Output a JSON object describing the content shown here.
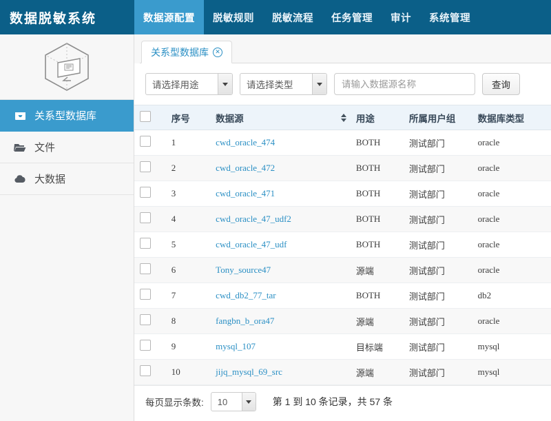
{
  "header": {
    "brand_title": "数据脱敏系统",
    "nav": [
      {
        "label": "数据源配置",
        "active": true
      },
      {
        "label": "脱敏规则",
        "active": false
      },
      {
        "label": "脱敏流程",
        "active": false
      },
      {
        "label": "任务管理",
        "active": false
      },
      {
        "label": "审计",
        "active": false
      },
      {
        "label": "系统管理",
        "active": false
      }
    ]
  },
  "sidebar": {
    "logo_icon": "hexagon-monitor-logo-icon",
    "items": [
      {
        "label": "关系型数据库",
        "icon": "database-inbox-icon",
        "active": true
      },
      {
        "label": "文件",
        "icon": "folder-open-icon",
        "active": false
      },
      {
        "label": "大数据",
        "icon": "cloud-icon",
        "active": false
      }
    ]
  },
  "tabs": [
    {
      "label": "关系型数据库",
      "closable": true,
      "active": true
    }
  ],
  "filters": {
    "purpose_select": "请选择用途",
    "type_select": "请选择类型",
    "search_placeholder": "请输入数据源名称",
    "search_value": "",
    "query_button": "查询"
  },
  "table": {
    "columns": [
      "",
      "序号",
      "数据源",
      "用途",
      "所属用户组",
      "数据库类型"
    ],
    "sortable_column": "数据源",
    "rows": [
      {
        "no": "1",
        "datasource": "cwd_oracle_474",
        "usage": "BOTH",
        "group": "测试部门",
        "dbtype": "oracle"
      },
      {
        "no": "2",
        "datasource": "cwd_oracle_472",
        "usage": "BOTH",
        "group": "测试部门",
        "dbtype": "oracle"
      },
      {
        "no": "3",
        "datasource": "cwd_oracle_471",
        "usage": "BOTH",
        "group": "测试部门",
        "dbtype": "oracle"
      },
      {
        "no": "4",
        "datasource": "cwd_oracle_47_udf2",
        "usage": "BOTH",
        "group": "测试部门",
        "dbtype": "oracle"
      },
      {
        "no": "5",
        "datasource": "cwd_oracle_47_udf",
        "usage": "BOTH",
        "group": "测试部门",
        "dbtype": "oracle"
      },
      {
        "no": "6",
        "datasource": "Tony_source47",
        "usage": "源端",
        "group": "测试部门",
        "dbtype": "oracle"
      },
      {
        "no": "7",
        "datasource": "cwd_db2_77_tar",
        "usage": "BOTH",
        "group": "测试部门",
        "dbtype": "db2"
      },
      {
        "no": "8",
        "datasource": "fangbn_b_ora47",
        "usage": "源端",
        "group": "测试部门",
        "dbtype": "oracle"
      },
      {
        "no": "9",
        "datasource": "mysql_107",
        "usage": "目标端",
        "group": "测试部门",
        "dbtype": "mysql"
      },
      {
        "no": "10",
        "datasource": "jijq_mysql_69_src",
        "usage": "源端",
        "group": "测试部门",
        "dbtype": "mysql"
      }
    ]
  },
  "footer": {
    "page_size_label": "每页显示条数:",
    "page_size_value": "10",
    "record_info": "第 1 到 10 条记录，共 57 条"
  },
  "colors": {
    "header_dark_blue": "#0b5f88",
    "accent_blue": "#3a9bcd",
    "link_blue": "#2a8fc4",
    "table_header_bg": "#edf4fa",
    "sidebar_bg": "#f7f7f7"
  }
}
